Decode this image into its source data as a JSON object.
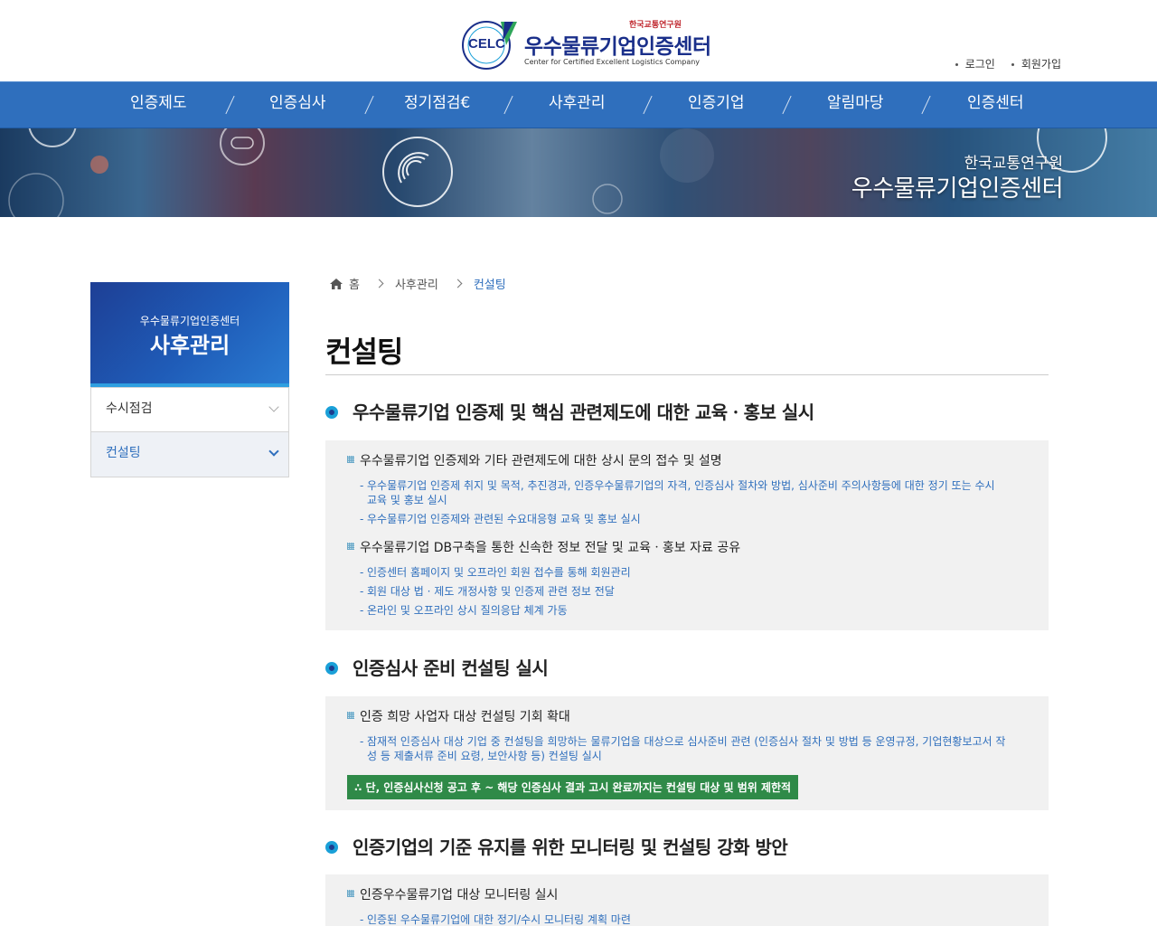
{
  "header": {
    "logo_emblem": "CELC",
    "logo_brand_sub": "한국교통연구원",
    "logo_title": "우수물류기업인증센터",
    "logo_eng": "Center for Certified Excellent Logistics Company",
    "util_links": [
      "로그인",
      "회원가입"
    ]
  },
  "gnb": {
    "items": [
      "인증제도",
      "인증심사",
      "정기점검€",
      "사후관리",
      "인증기업",
      "알림마당",
      "인증센터"
    ]
  },
  "visual": {
    "sub": "한국교통연구원",
    "title": "우수물류기업인증센터"
  },
  "lnb": {
    "sub": "우수물류기업인증센터",
    "title": "사후관리",
    "items": [
      {
        "label": "수시점검",
        "active": false
      },
      {
        "label": "컨설팅",
        "active": true
      }
    ]
  },
  "breadcrumb": {
    "home": "홈",
    "level1": "사후관리",
    "current": "컨설팅"
  },
  "page_title": "컨설팅",
  "sections": [
    {
      "title": "우수물류기업 인증제 및 핵심 관련제도에 대한 교육ㆍ홍보 실시",
      "groups": [
        {
          "head": "우수물류기업 인증제와 기타 관련제도에 대한 상시 문의 접수 및 설명",
          "items": [
            "우수물류기업 인증제 취지 및 목적, 추진경과, 인증우수물류기업의 자격, 인증심사 절차와 방법, 심사준비 주의사항등에 대한 정기 또는 수시 교육 및 홍보 실시",
            "우수물류기업 인증제와 관련된 수요대응형 교육 및 홍보 실시"
          ]
        },
        {
          "head": "우수물류기업 DB구축을 통한 신속한 정보 전달 및 교육ㆍ홍보 자료 공유",
          "items": [
            "인증센터 홈페이지 및 오프라인 회원 접수를 통해 회원관리",
            "회원 대상 법 · 제도 개정사항 및 인증제 관련 정보 전달",
            "온라인 및 오프라인 상시 질의응답 체계 가동"
          ]
        }
      ]
    },
    {
      "title": "인증심사 준비 컨설팅 실시",
      "groups": [
        {
          "head": "인증 희망 사업자 대상 컨설팅 기회 확대",
          "items": [
            "잠재적 인증심사 대상 기업 중 컨설팅을 희망하는 물류기업을 대상으로 심사준비 관련 (인증심사 절차 및 방법 등 운영규정, 기업현황보고서 작성 등 제출서류 준비 요령, 보안사항 등) 컨설팅 실시"
          ]
        }
      ],
      "notice": "∴ 단, 인증심사신청 공고 후 ~ 해당 인증심사 결과 고시 완료까지는 컨설팅 대상 및 범위 제한적"
    },
    {
      "title": "인증기업의 기준 유지를 위한 모니터링 및 컨설팅 강화 방안",
      "groups": [
        {
          "head": "인증우수물류기업 대상 모니터링 실시",
          "items": [
            "인증된 우수물류기업에 대한 정기/수시 모니터링 계획 마련"
          ]
        }
      ]
    }
  ],
  "colors": {
    "primary_blue": "#2f6fbd",
    "notice_green": "#2f8a48",
    "logo_navy": "#1a2f8a"
  }
}
